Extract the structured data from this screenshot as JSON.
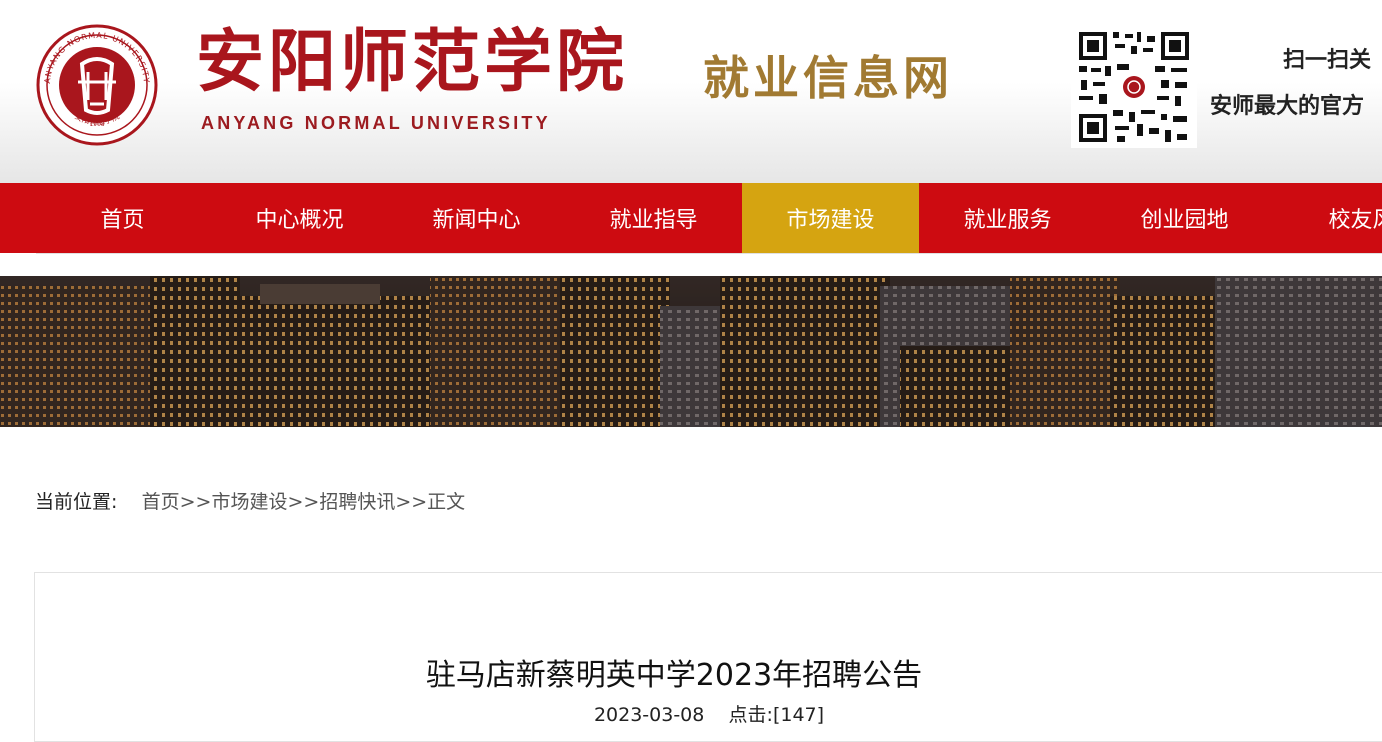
{
  "header": {
    "school_cn": "安阳师范学院",
    "school_en": "ANYANG NORMAL UNIVERSITY",
    "site_name": "就业信息网",
    "seal_ring_text": "ANYANG NORMAL UNIVERSITY",
    "seal_bottom_text": "安阳师范学院",
    "seal_year": "1908",
    "qr_line1": "扫一扫关",
    "qr_line2": "安师最大的官方"
  },
  "nav": {
    "items": [
      {
        "label": "首页",
        "active": false
      },
      {
        "label": "中心概况",
        "active": false
      },
      {
        "label": "新闻中心",
        "active": false
      },
      {
        "label": "就业指导",
        "active": false
      },
      {
        "label": "市场建设",
        "active": true
      },
      {
        "label": "就业服务",
        "active": false
      },
      {
        "label": "创业园地",
        "active": false
      },
      {
        "label": "校友风",
        "active": false
      }
    ]
  },
  "breadcrumb": {
    "label": "当前位置:",
    "items": [
      "首页",
      "市场建设",
      "招聘快讯",
      "正文"
    ],
    "separator": ">>"
  },
  "article": {
    "title": "驻马店新蔡明英中学2023年招聘公告",
    "date": "2023-03-08",
    "clicks_label": "点击:",
    "clicks_value": "[147]"
  },
  "colors": {
    "nav_red": "#cd0b11",
    "nav_active_gold": "#d5a411",
    "brand_red": "#a9161d",
    "site_gold": "#a17a32"
  }
}
